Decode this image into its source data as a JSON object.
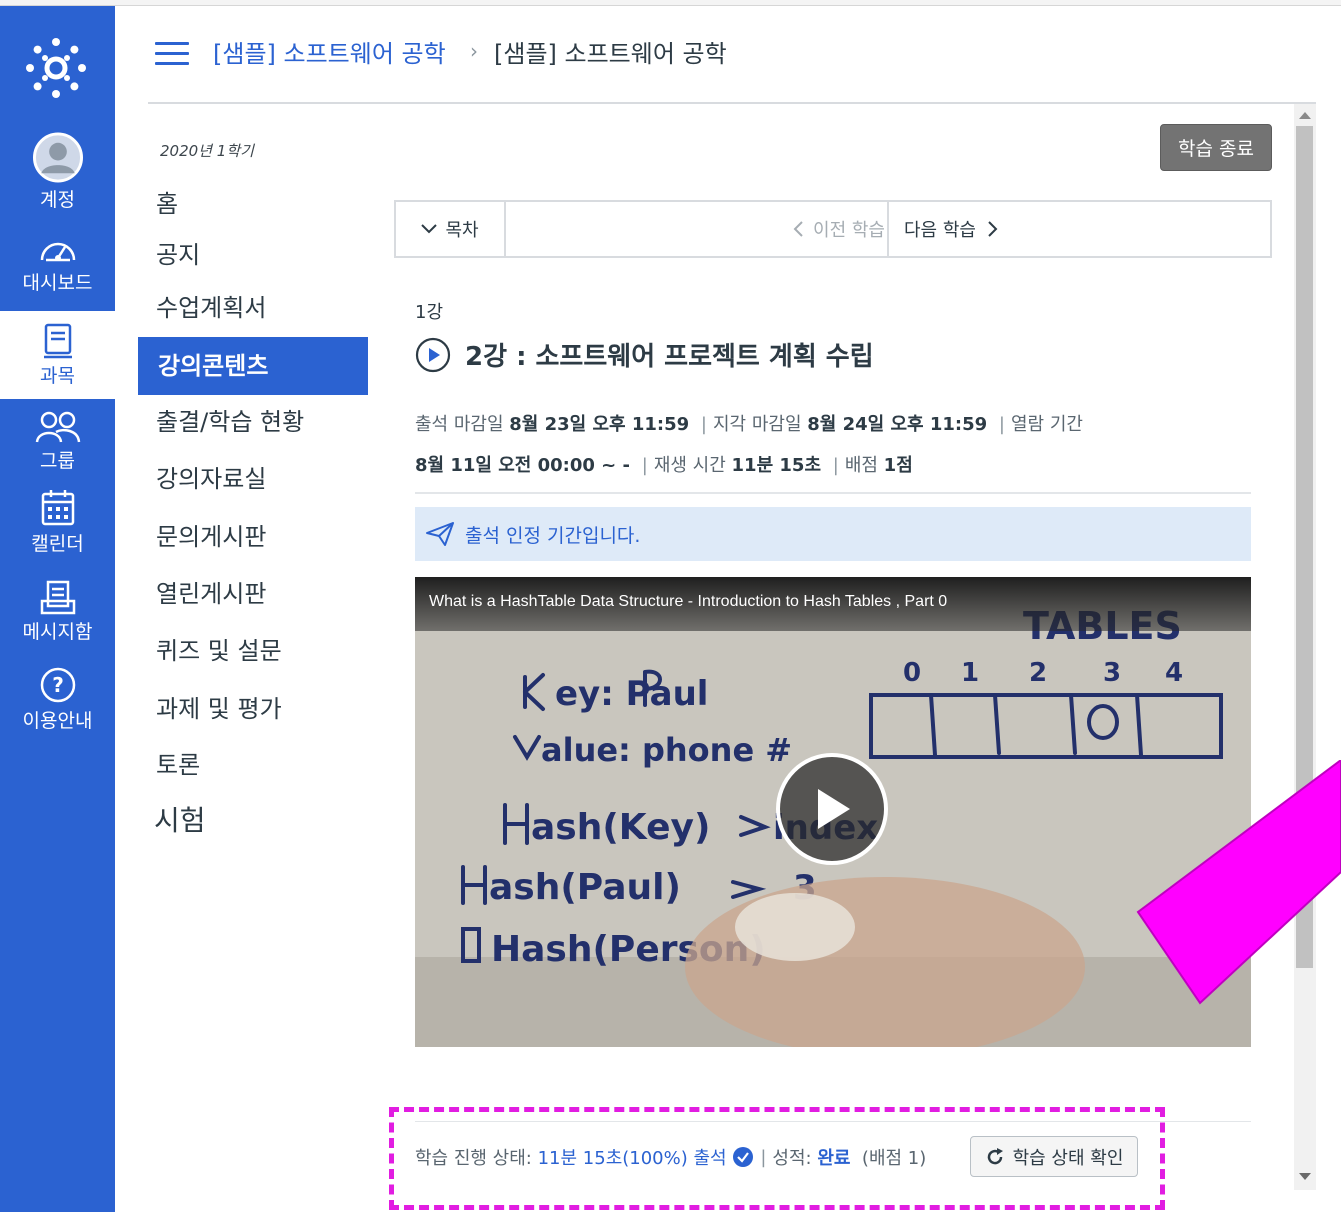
{
  "global_nav": {
    "items": [
      {
        "label": "계정",
        "icon": "account-icon"
      },
      {
        "label": "대시보드",
        "icon": "dashboard-icon"
      },
      {
        "label": "과목",
        "icon": "courses-icon"
      },
      {
        "label": "그룹",
        "icon": "groups-icon"
      },
      {
        "label": "캘린더",
        "icon": "calendar-icon"
      },
      {
        "label": "메시지함",
        "icon": "inbox-icon"
      },
      {
        "label": "이용안내",
        "icon": "help-icon"
      }
    ],
    "active": "과목"
  },
  "breadcrumb": {
    "course": "[샘플] 소프트웨어 공학",
    "separator": "›",
    "current": "[샘플] 소프트웨어 공학"
  },
  "course_nav": {
    "term": "2020년 1학기",
    "items": [
      {
        "label": "홈"
      },
      {
        "label": "공지"
      },
      {
        "label": "수업계획서"
      },
      {
        "label": "강의콘텐츠"
      },
      {
        "label": "출결/학습 현황"
      },
      {
        "label": "강의자료실"
      },
      {
        "label": "문의게시판"
      },
      {
        "label": "열린게시판"
      },
      {
        "label": "퀴즈 및 설문"
      },
      {
        "label": "과제 및 평가"
      },
      {
        "label": "토론"
      },
      {
        "label": "시험"
      }
    ],
    "active": "강의콘텐츠"
  },
  "content": {
    "end_button": "학습 종료",
    "toc_label": "목차",
    "prev_label": "이전 학습",
    "next_label": "다음 학습",
    "week": "1강",
    "title": "2강 : 소프트웨어 프로젝트 계획 수립",
    "meta": {
      "attend_deadline_label": "출석 마감일",
      "attend_deadline": "8월 23일 오후 11:59",
      "late_deadline_label": "지각 마감일",
      "late_deadline": "8월 24일 오후 11:59",
      "open_period_label": "열람 기간",
      "open_period": "8월 11일 오전 00:00 ~ -",
      "play_time_label": "재생 시간",
      "play_time": "11분 15초",
      "score_label": "배점",
      "score": "1점"
    },
    "notice": "출석 인정 기간입니다.",
    "video": {
      "title": "What is a HashTable Data Structure - Introduction to Hash Tables , Part 0"
    },
    "status": {
      "progress_label": "학습 진행 상태:",
      "progress_value": "11분 15초(100%) 출석",
      "grade_label": "성적:",
      "grade_value": "완료",
      "score_note": "(배점 1)",
      "check_button": "학습 상태 확인"
    }
  },
  "colors": {
    "brand": "#2b62d1",
    "notice_bg": "#deeaf8",
    "highlight": "#e11de1",
    "end_button_bg": "#737373"
  }
}
